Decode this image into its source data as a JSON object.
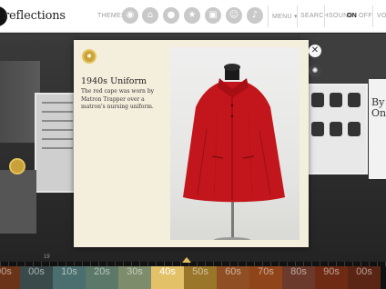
{
  "header": {
    "logo_text": "reflections",
    "themes_label": "THEMES",
    "theme_icons": [
      "bicycle-icon",
      "house-icon",
      "lightbulb-icon",
      "trophy-icon",
      "bus-icon",
      "mask-icon",
      "music-note-icon"
    ],
    "menu_label": "MENU ▾",
    "search_label": "SEARCH",
    "sound_label": "SOUND",
    "sound_on": "ON",
    "sound_off": "OFF",
    "voice_label": "VO"
  },
  "card": {
    "title": "1940s Uniform",
    "description": "The red cape was worn by Matron Trapper over a matron's nursing uniform."
  },
  "background": {
    "right_text": "By\nOne"
  },
  "timeline": {
    "marker_label": "19",
    "decades": [
      "90s",
      "00s",
      "10s",
      "20s",
      "30s",
      "40s",
      "50s",
      "60s",
      "70s",
      "80s",
      "90s",
      "00s"
    ],
    "active_index": 5,
    "colors": [
      "#6b3318",
      "#3a4a4b",
      "#4b6f6e",
      "#5c7869",
      "#7d8c6b",
      "#e3c169",
      "#9a762a",
      "#8f4e23",
      "#8f4419",
      "#6b3a2c",
      "#6e2a12",
      "#5a2514"
    ]
  },
  "colors": {
    "cape_red": "#c3161c",
    "card_bg": "#f4eedd",
    "seal_gold": "#c9a23c"
  }
}
